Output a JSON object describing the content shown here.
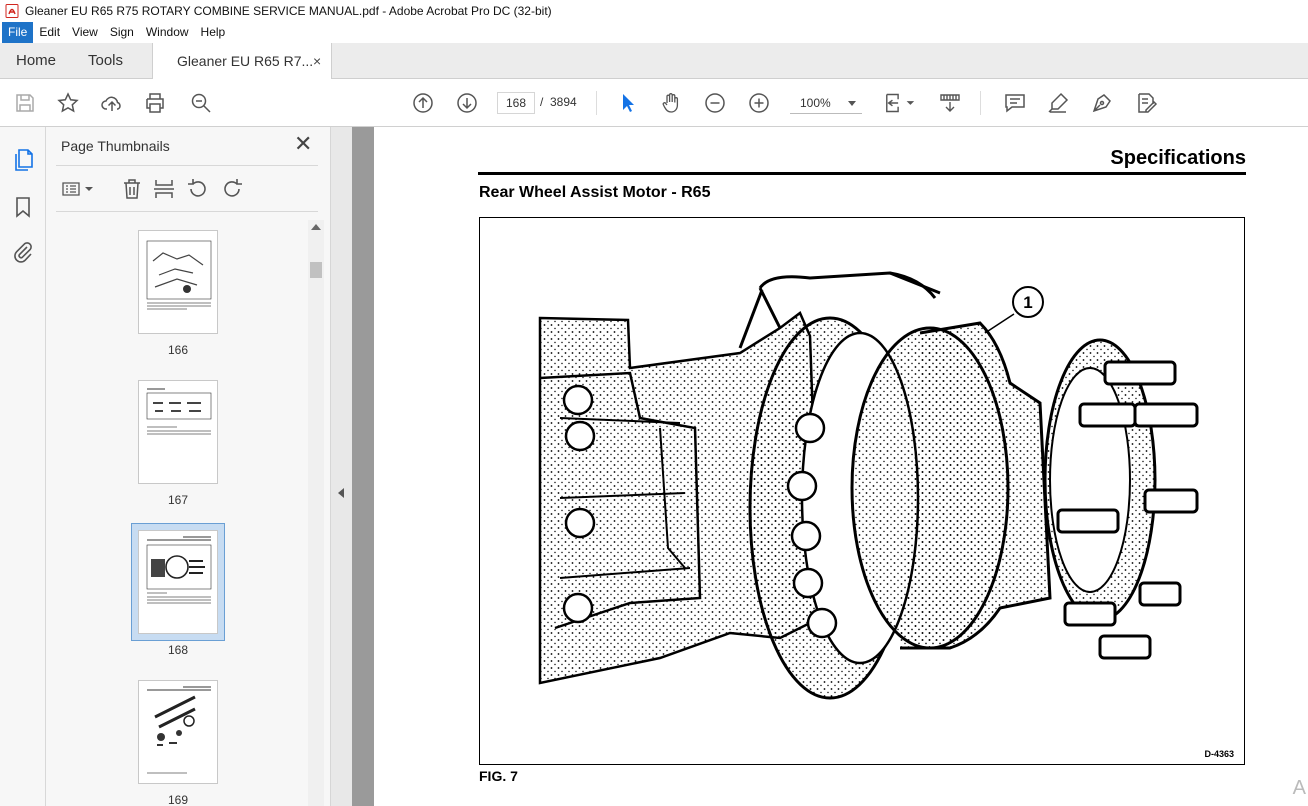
{
  "window": {
    "title": "Gleaner EU R65  R75 ROTARY COMBINE SERVICE MANUAL.pdf - Adobe Acrobat Pro DC (32-bit)"
  },
  "menu": [
    "File",
    "Edit",
    "View",
    "Sign",
    "Window",
    "Help"
  ],
  "tabs": {
    "home": "Home",
    "tools": "Tools",
    "document": "Gleaner EU R65  R7...",
    "close_glyph": "×"
  },
  "toolbar": {
    "current_page": "168",
    "page_separator": "/",
    "total_pages": "3894",
    "zoom": "100%"
  },
  "thumbnails": {
    "title": "Page Thumbnails",
    "close_glyph": "✕",
    "items": [
      {
        "page": "166",
        "selected": false
      },
      {
        "page": "167",
        "selected": false
      },
      {
        "page": "168",
        "selected": true
      },
      {
        "page": "169",
        "selected": false
      }
    ]
  },
  "document": {
    "header": "Specifications",
    "section_title": "Rear Wheel Assist Motor - R65",
    "callout": "1",
    "figure_code": "D-4363",
    "caption": "FIG. 7",
    "corner_fragment": "A"
  },
  "colors": {
    "menu_active": "#1e73c8",
    "acrobat_red": "#d1261f",
    "icon_blue": "#1473e6",
    "selection_fill": "#c7dcf2"
  }
}
